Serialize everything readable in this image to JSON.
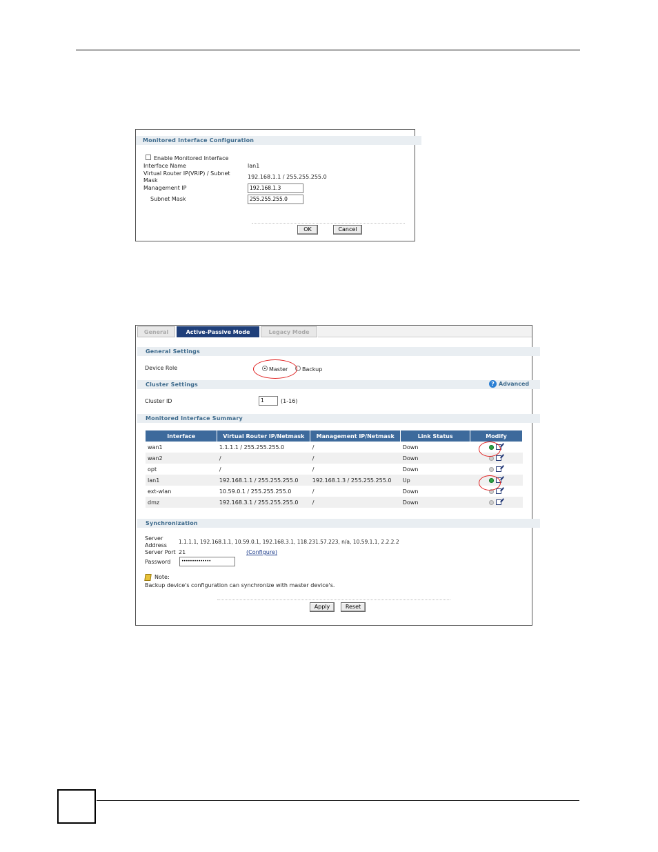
{
  "panel1": {
    "title": "Monitored Interface Configuration",
    "enable_label": "Enable Monitored Interface",
    "enable_checked": false,
    "interface_name_label": "Interface Name",
    "interface_name_value": "lan1",
    "vrip_label_line1": "Virtual Router IP(VRIP) / Subnet",
    "vrip_label_line2": "Mask",
    "vrip_value": "192.168.1.1 / 255.255.255.0",
    "mgmt_ip_label": "Management IP",
    "mgmt_ip_value": "192.168.1.3",
    "subnet_mask_label": "Subnet Mask",
    "subnet_mask_value": "255.255.255.0",
    "ok_label": "OK",
    "cancel_label": "Cancel"
  },
  "panel2": {
    "tabs": [
      {
        "label": "General",
        "active": false
      },
      {
        "label": "Active-Passive Mode",
        "active": true
      },
      {
        "label": "Legacy Mode",
        "active": false
      }
    ],
    "general_settings_title": "General Settings",
    "device_role_label": "Device Role",
    "role_master_label": "Master",
    "role_backup_label": "Backup",
    "role_selected": "Master",
    "cluster_settings_title": "Cluster Settings",
    "advanced_label": "Advanced",
    "cluster_id_label": "Cluster ID",
    "cluster_id_value": "1",
    "cluster_id_range": "(1-16)",
    "summary_title": "Monitored Interface Summary",
    "summary_headers": [
      "Interface",
      "Virtual Router IP/Netmask",
      "Management IP/Netmask",
      "Link Status",
      "Modify"
    ],
    "summary_rows": [
      {
        "iface": "wan1",
        "vrip": "1.1.1.1 / 255.255.255.0",
        "mgmt": "/",
        "status": "Down",
        "active": true
      },
      {
        "iface": "wan2",
        "vrip": "/",
        "mgmt": "/",
        "status": "Down",
        "active": false
      },
      {
        "iface": "opt",
        "vrip": "/",
        "mgmt": "/",
        "status": "Down",
        "active": false
      },
      {
        "iface": "lan1",
        "vrip": "192.168.1.1 / 255.255.255.0",
        "mgmt": "192.168.1.3 / 255.255.255.0",
        "status": "Up",
        "active": true
      },
      {
        "iface": "ext-wlan",
        "vrip": "10.59.0.1 / 255.255.255.0",
        "mgmt": "/",
        "status": "Down",
        "active": false
      },
      {
        "iface": "dmz",
        "vrip": "192.168.3.1 / 255.255.255.0",
        "mgmt": "/",
        "status": "Down",
        "active": false
      }
    ],
    "sync_title": "Synchronization",
    "server_address_label_line1": "Server",
    "server_address_label_line2": "Address",
    "server_address_value": "1.1.1.1, 192.168.1.1, 10.59.0.1, 192.168.3.1, 118.231.57.223, n/a, 10.59.1.1, 2.2.2.2",
    "server_port_label": "Server Port",
    "server_port_value": "21",
    "configure_link": "Configure",
    "password_label": "Password",
    "password_value": "••••••••••••••",
    "note_label": "Note:",
    "note_text": "Backup device's configuration can synchronize with master device's.",
    "apply_label": "Apply",
    "reset_label": "Reset"
  }
}
